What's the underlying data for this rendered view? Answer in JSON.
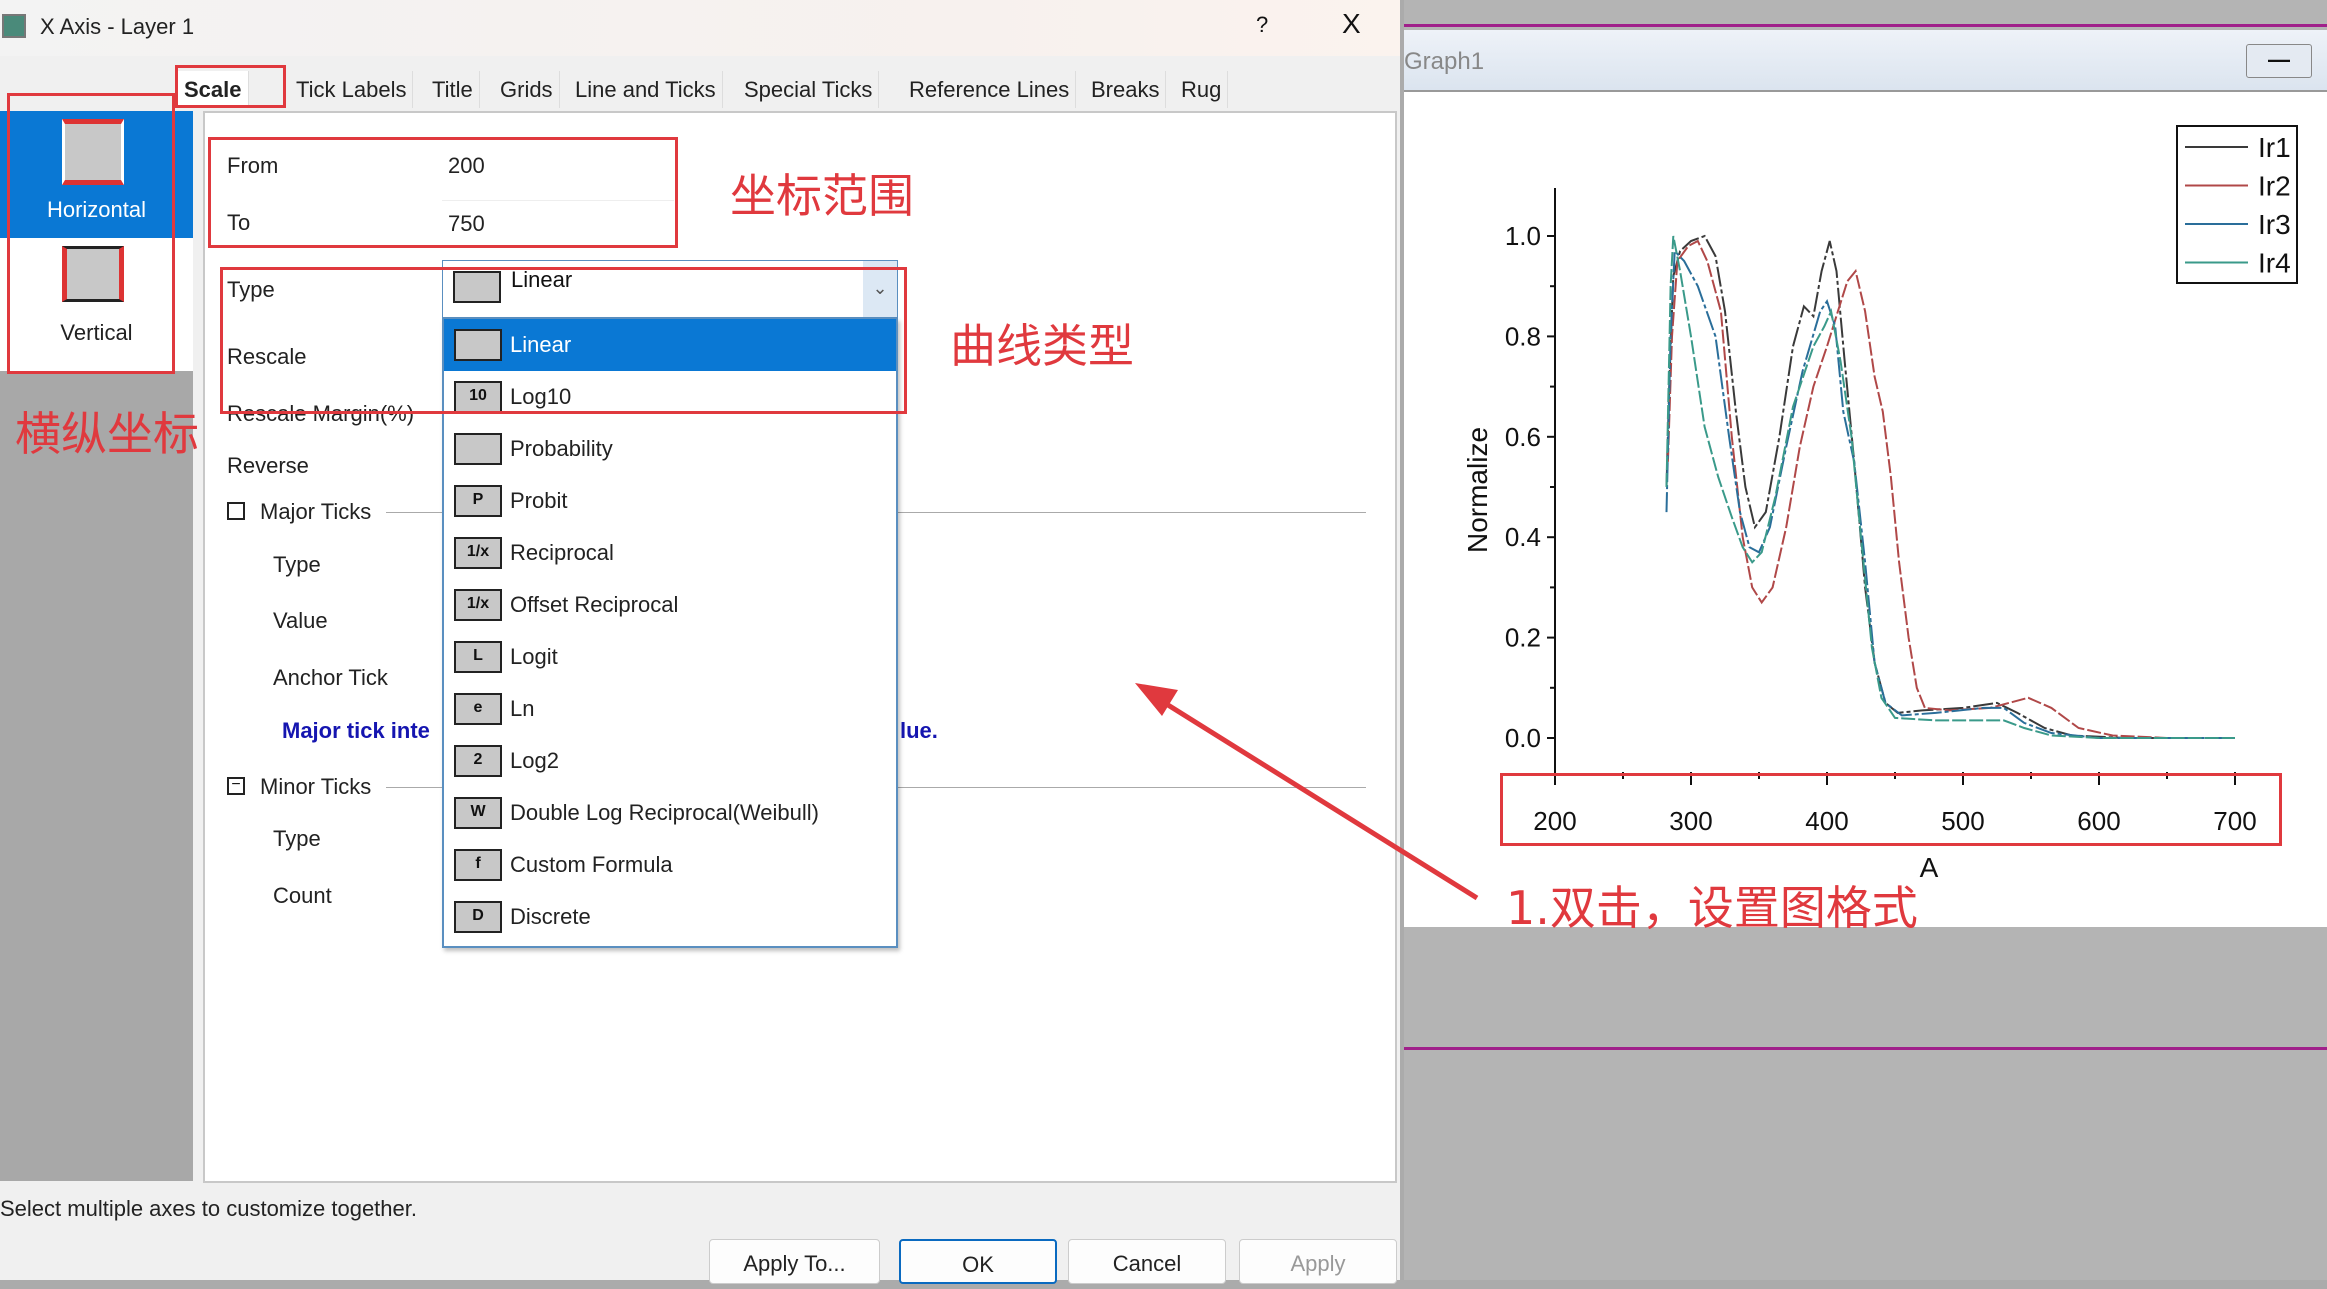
{
  "dialog": {
    "title": "X Axis - Layer 1",
    "help_label": "?",
    "close_label": "X",
    "tabs": [
      "Scale",
      "Tick Labels",
      "Title",
      "Grids",
      "Line and Ticks",
      "Special Ticks",
      "Reference Lines",
      "Breaks",
      "Rug"
    ],
    "active_tab": "Scale",
    "axes": [
      {
        "label": "Horizontal",
        "selected": true
      },
      {
        "label": "Vertical",
        "selected": false
      }
    ],
    "fields": {
      "from_label": "From",
      "from_value": "200",
      "to_label": "To",
      "to_value": "750",
      "type_label": "Type",
      "type_value": "Linear",
      "rescale_label": "Rescale",
      "rescale_margin_label": "Rescale Margin(%)",
      "reverse_label": "Reverse",
      "major_ticks_label": "Major Ticks",
      "major_type_label": "Type",
      "major_value_label": "Value",
      "anchor_tick_label": "Anchor Tick",
      "major_note_left": "Major tick inte",
      "major_note_right": "lue.",
      "minor_ticks_label": "Minor Ticks",
      "minor_type_label": "Type",
      "minor_count_label": "Count"
    },
    "type_options": [
      {
        "label": "Linear",
        "icon": "linear-scale-icon",
        "glyph": "",
        "selected": true
      },
      {
        "label": "Log10",
        "icon": "log10-scale-icon",
        "glyph": "10"
      },
      {
        "label": "Probability",
        "icon": "probability-scale-icon",
        "glyph": ""
      },
      {
        "label": "Probit",
        "icon": "probit-scale-icon",
        "glyph": "P"
      },
      {
        "label": "Reciprocal",
        "icon": "reciprocal-scale-icon",
        "glyph": "1/x"
      },
      {
        "label": "Offset Reciprocal",
        "icon": "offset-reciprocal-scale-icon",
        "glyph": "1/x"
      },
      {
        "label": "Logit",
        "icon": "logit-scale-icon",
        "glyph": "L"
      },
      {
        "label": "Ln",
        "icon": "ln-scale-icon",
        "glyph": "e"
      },
      {
        "label": "Log2",
        "icon": "log2-scale-icon",
        "glyph": "2"
      },
      {
        "label": "Double Log Reciprocal(Weibull)",
        "icon": "weibull-scale-icon",
        "glyph": "W"
      },
      {
        "label": "Custom Formula",
        "icon": "custom-formula-icon",
        "glyph": "f"
      },
      {
        "label": "Discrete",
        "icon": "discrete-scale-icon",
        "glyph": "D"
      }
    ],
    "status_text": "Select multiple axes to customize together.",
    "buttons": {
      "apply_to": "Apply To...",
      "ok": "OK",
      "cancel": "Cancel",
      "apply": "Apply"
    }
  },
  "annotations": {
    "range": "坐标范围",
    "curve_type": "曲线类型",
    "axes": "横纵坐标",
    "step1": "1.双击，设置图格式",
    "color": "#e0393e"
  },
  "graph_window": {
    "title": "Graph1",
    "minimize_label": "—"
  },
  "chart_data": {
    "type": "line",
    "xlabel": "A",
    "ylabel": "Normalize",
    "xlim": [
      200,
      700
    ],
    "ylim": [
      -0.08,
      1.1
    ],
    "xticks": [
      "200",
      "300",
      "400",
      "500",
      "600",
      "700"
    ],
    "yticks": [
      "0.0",
      "0.2",
      "0.4",
      "0.6",
      "0.8",
      "1.0"
    ],
    "legend_position": "top-right",
    "series": [
      {
        "name": "Ir1",
        "color": "#3a3a3a",
        "points": [
          [
            282,
            0.5
          ],
          [
            284,
            0.7
          ],
          [
            287,
            0.92
          ],
          [
            292,
            0.97
          ],
          [
            300,
            0.99
          ],
          [
            310,
            1.0
          ],
          [
            318,
            0.96
          ],
          [
            325,
            0.85
          ],
          [
            333,
            0.65
          ],
          [
            340,
            0.5
          ],
          [
            347,
            0.42
          ],
          [
            355,
            0.45
          ],
          [
            365,
            0.6
          ],
          [
            375,
            0.78
          ],
          [
            383,
            0.86
          ],
          [
            390,
            0.84
          ],
          [
            396,
            0.93
          ],
          [
            402,
            0.99
          ],
          [
            407,
            0.93
          ],
          [
            413,
            0.75
          ],
          [
            420,
            0.55
          ],
          [
            428,
            0.3
          ],
          [
            435,
            0.15
          ],
          [
            443,
            0.07
          ],
          [
            452,
            0.05
          ],
          [
            470,
            0.055
          ],
          [
            500,
            0.06
          ],
          [
            525,
            0.07
          ],
          [
            540,
            0.05
          ],
          [
            560,
            0.02
          ],
          [
            580,
            0.005
          ],
          [
            620,
            0
          ],
          [
            700,
            0
          ]
        ]
      },
      {
        "name": "Ir2",
        "color": "#b04848",
        "points": [
          [
            283,
            0.55
          ],
          [
            286,
            0.8
          ],
          [
            290,
            0.95
          ],
          [
            298,
            0.98
          ],
          [
            305,
            0.99
          ],
          [
            312,
            0.95
          ],
          [
            322,
            0.85
          ],
          [
            330,
            0.6
          ],
          [
            338,
            0.4
          ],
          [
            345,
            0.3
          ],
          [
            352,
            0.27
          ],
          [
            360,
            0.3
          ],
          [
            370,
            0.42
          ],
          [
            380,
            0.58
          ],
          [
            390,
            0.7
          ],
          [
            400,
            0.78
          ],
          [
            408,
            0.85
          ],
          [
            415,
            0.91
          ],
          [
            421,
            0.93
          ],
          [
            428,
            0.85
          ],
          [
            435,
            0.72
          ],
          [
            441,
            0.65
          ],
          [
            447,
            0.52
          ],
          [
            453,
            0.35
          ],
          [
            460,
            0.2
          ],
          [
            466,
            0.1
          ],
          [
            472,
            0.06
          ],
          [
            490,
            0.055
          ],
          [
            520,
            0.06
          ],
          [
            548,
            0.08
          ],
          [
            565,
            0.06
          ],
          [
            585,
            0.02
          ],
          [
            610,
            0.005
          ],
          [
            650,
            0
          ],
          [
            700,
            0
          ]
        ]
      },
      {
        "name": "Ir3",
        "color": "#2a6e9a",
        "points": [
          [
            282,
            0.45
          ],
          [
            285,
            0.8
          ],
          [
            288,
            0.97
          ],
          [
            295,
            0.95
          ],
          [
            305,
            0.9
          ],
          [
            318,
            0.8
          ],
          [
            328,
            0.6
          ],
          [
            336,
            0.45
          ],
          [
            343,
            0.38
          ],
          [
            350,
            0.37
          ],
          [
            358,
            0.42
          ],
          [
            370,
            0.58
          ],
          [
            382,
            0.73
          ],
          [
            395,
            0.85
          ],
          [
            400,
            0.87
          ],
          [
            406,
            0.82
          ],
          [
            412,
            0.65
          ],
          [
            420,
            0.55
          ],
          [
            428,
            0.35
          ],
          [
            435,
            0.15
          ],
          [
            443,
            0.07
          ],
          [
            455,
            0.045
          ],
          [
            480,
            0.05
          ],
          [
            515,
            0.06
          ],
          [
            530,
            0.06
          ],
          [
            545,
            0.03
          ],
          [
            565,
            0.01
          ],
          [
            600,
            0
          ],
          [
            700,
            0
          ]
        ]
      },
      {
        "name": "Ir4",
        "color": "#3a9a8a",
        "points": [
          [
            282,
            0.5
          ],
          [
            285,
            0.9
          ],
          [
            287,
            1.0
          ],
          [
            292,
            0.93
          ],
          [
            300,
            0.8
          ],
          [
            310,
            0.62
          ],
          [
            320,
            0.52
          ],
          [
            330,
            0.44
          ],
          [
            338,
            0.38
          ],
          [
            345,
            0.35
          ],
          [
            352,
            0.37
          ],
          [
            362,
            0.48
          ],
          [
            375,
            0.66
          ],
          [
            390,
            0.78
          ],
          [
            398,
            0.82
          ],
          [
            403,
            0.85
          ],
          [
            410,
            0.75
          ],
          [
            418,
            0.6
          ],
          [
            425,
            0.4
          ],
          [
            433,
            0.18
          ],
          [
            440,
            0.08
          ],
          [
            450,
            0.04
          ],
          [
            480,
            0.035
          ],
          [
            530,
            0.035
          ],
          [
            545,
            0.02
          ],
          [
            565,
            0.005
          ],
          [
            600,
            0
          ],
          [
            700,
            0
          ]
        ]
      }
    ]
  }
}
